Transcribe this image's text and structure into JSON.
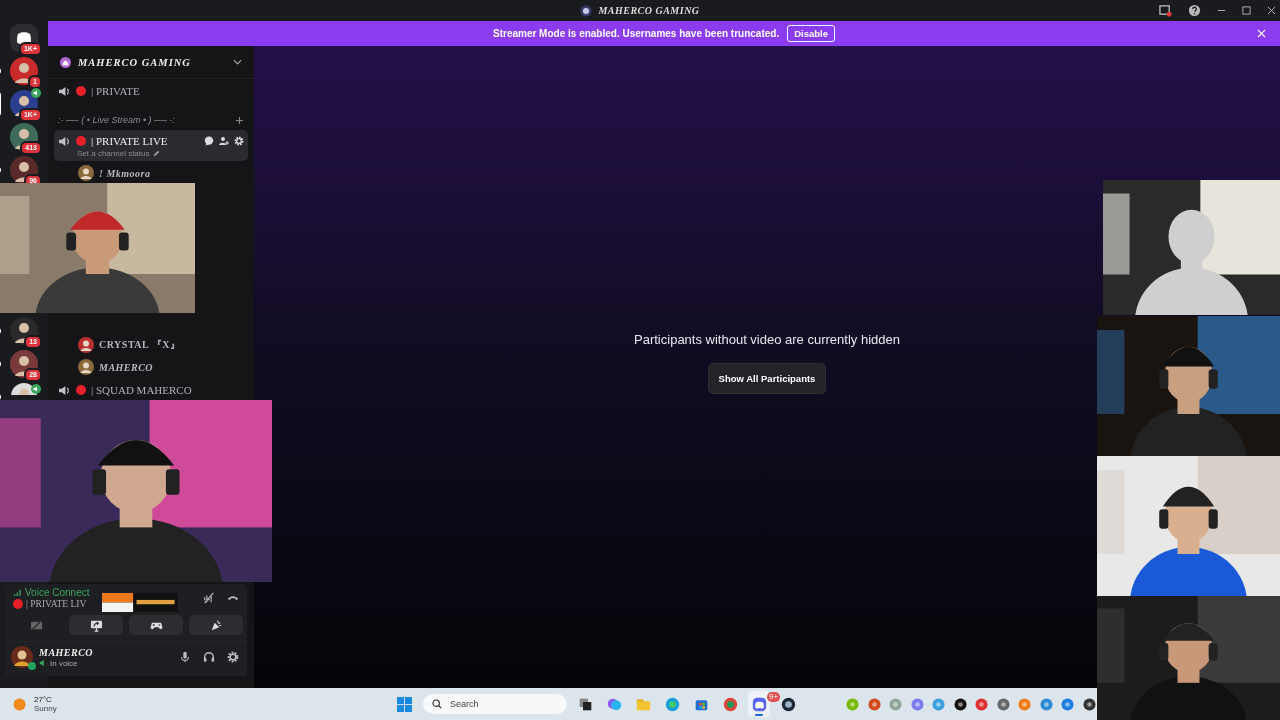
{
  "window": {
    "title": "MAHERCO GAMING"
  },
  "banner": {
    "text": "Streamer Mode is enabled. Usernames have been truncated.",
    "button": "Disable"
  },
  "servers": [
    {
      "kind": "home",
      "badge": "1K+",
      "selected": false,
      "unread": false,
      "speaking": false
    },
    {
      "kind": "avatar",
      "badge": "1",
      "selected": false,
      "unread": true,
      "speaking": false
    },
    {
      "kind": "avatar",
      "badge": "1K+",
      "selected": true,
      "unread": false,
      "speaking": true
    },
    {
      "kind": "avatar",
      "badge": "413",
      "selected": false,
      "unread": false,
      "speaking": false
    },
    {
      "kind": "avatar",
      "badge": "96",
      "selected": false,
      "unread": true,
      "speaking": false
    },
    {
      "kind": "avatar",
      "badge": "13",
      "selected": false,
      "unread": true,
      "speaking": false
    },
    {
      "kind": "avatar",
      "badge": "28",
      "selected": false,
      "unread": true,
      "speaking": false
    },
    {
      "kind": "avatar",
      "selected": false,
      "unread": true,
      "speaking": true
    }
  ],
  "sidebar": {
    "server_name": "MAHERCO GAMING",
    "channels": [
      {
        "kind": "voice",
        "name": "| PRIVATE",
        "selected": false
      },
      {
        "kind": "category",
        "name": ":- ── ( • Live Stream • ) ── -:"
      },
      {
        "kind": "voice",
        "name": "| PRIVATE LIVE",
        "selected": true,
        "status": "Set a channel status"
      },
      {
        "kind": "user",
        "name": "! Mkmoora",
        "italic": true
      }
    ],
    "channels_lower": [
      {
        "kind": "user",
        "name": "CRYSTAL 『X』",
        "italic": false
      },
      {
        "kind": "user",
        "name": "MAHERCO",
        "italic": true
      },
      {
        "kind": "voice",
        "name": "| SQUAD MAHERCO",
        "selected": false
      }
    ]
  },
  "voice_panel": {
    "status": "Voice Connect",
    "channel": "| PRIVATE LIV"
  },
  "user_panel": {
    "name": "MAHERCO",
    "status": "In voice"
  },
  "main": {
    "message": "Participants without video are currently hidden",
    "button": "Show All Participants"
  },
  "taskbar": {
    "temperature": "27°C",
    "weather": "Sunny",
    "search": {
      "placeholder": "Search"
    },
    "discord_badge": "9+",
    "apps": [
      {
        "selected": false
      },
      {
        "selected": false
      },
      {
        "selected": false
      },
      {
        "selected": false
      },
      {
        "selected": false
      },
      {
        "selected": false
      },
      {
        "selected": true
      },
      {
        "selected": false
      }
    ]
  }
}
